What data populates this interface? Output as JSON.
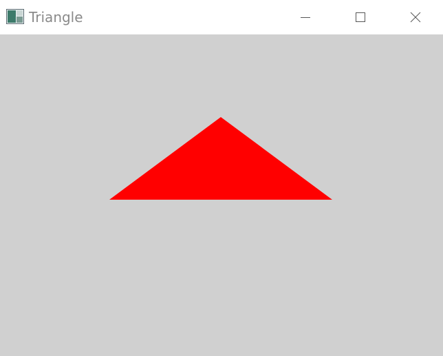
{
  "window": {
    "title": "Triangle",
    "app_icon": "window-app-icon",
    "buttons": {
      "minimize_icon": "minimize-icon",
      "maximize_icon": "maximize-icon",
      "close_icon": "close-icon"
    }
  },
  "canvas": {
    "background_color": "#d0d0d0",
    "shape": {
      "type": "triangle",
      "fill_color": "#ff0000"
    }
  }
}
